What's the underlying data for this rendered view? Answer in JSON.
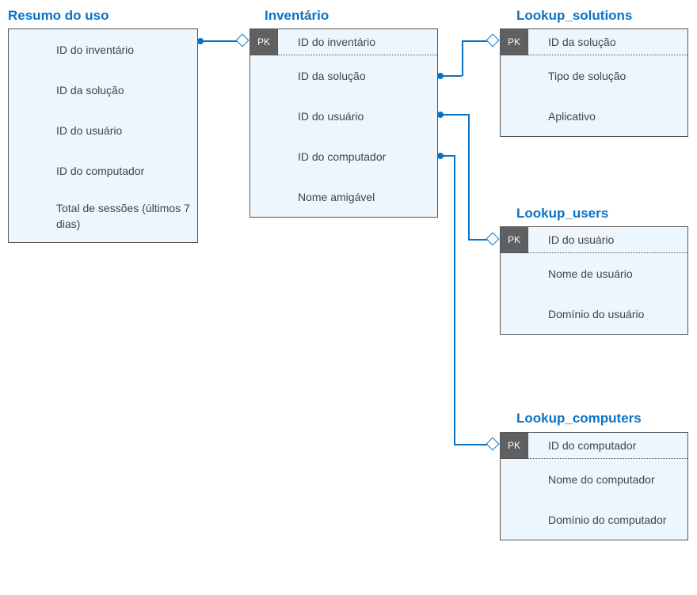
{
  "entities": {
    "usage_summary": {
      "title": "Resumo do uso",
      "fields": [
        "ID do inventário",
        "ID da solução",
        "ID do usuário",
        "ID do computador",
        "Total de sessões (últimos 7 dias)"
      ]
    },
    "inventory": {
      "title": "Inventário",
      "pk": "PK",
      "fields": [
        "ID do inventário",
        "ID da solução",
        "ID do usuário",
        "ID do computador",
        "Nome amigável"
      ]
    },
    "lookup_solutions": {
      "title": "Lookup_solutions",
      "pk": "PK",
      "fields": [
        "ID da solução",
        "Tipo de solução",
        "Aplicativo"
      ]
    },
    "lookup_users": {
      "title": "Lookup_users",
      "pk": "PK",
      "fields": [
        "ID do usuário",
        "Nome de usuário",
        "Domínio do usuário"
      ]
    },
    "lookup_computers": {
      "title": "Lookup_computers",
      "pk": "PK",
      "fields": [
        "ID do computador",
        "Nome do computador",
        "Domínio do computador"
      ]
    }
  }
}
